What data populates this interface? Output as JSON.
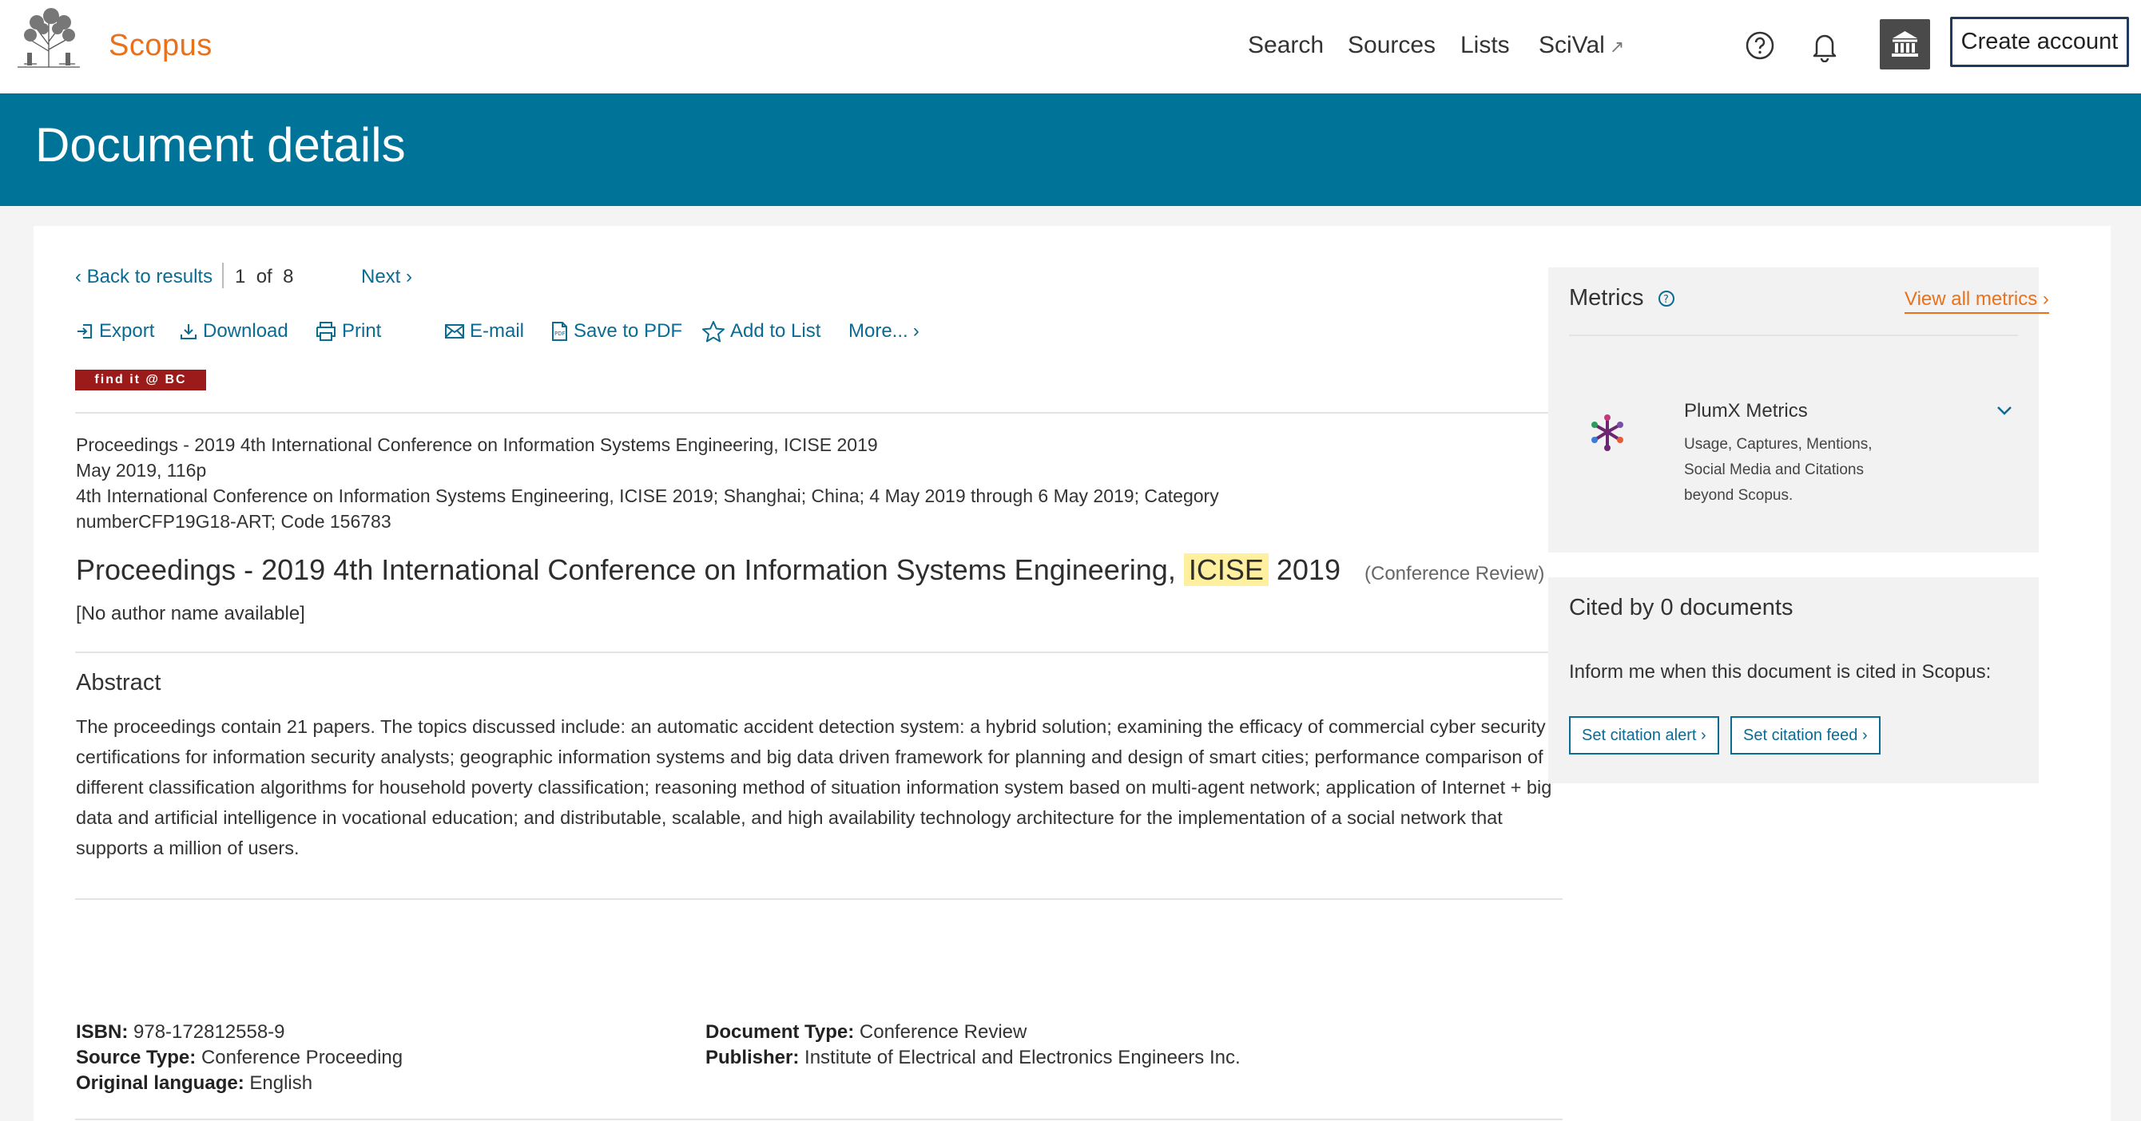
{
  "header": {
    "brand": "Scopus",
    "nav": [
      "Search",
      "Sources",
      "Lists",
      "SciVal"
    ],
    "create_account": "Create account"
  },
  "banner": {
    "title": "Document details"
  },
  "pager": {
    "back": "Back to results",
    "current": "1",
    "of": "of",
    "total": "8",
    "next": "Next"
  },
  "actions": {
    "export": "Export",
    "download": "Download",
    "print": "Print",
    "email": "E-mail",
    "save_pdf": "Save to PDF",
    "add_list": "Add to List",
    "more": "More..."
  },
  "findit": "find it @ BC",
  "source": {
    "line1": "Proceedings - 2019 4th International Conference on Information Systems Engineering, ICISE 2019",
    "line2": "May 2019, 116p",
    "line3": "4th International Conference on Information Systems Engineering, ICISE 2019; Shanghai; China; 4 May 2019 through 6 May 2019; Category",
    "line4": "numberCFP19G18-ART; Code 156783"
  },
  "document": {
    "title_before": "Proceedings - 2019 4th International Conference on Information Systems Engineering,",
    "title_highlight": "ICISE",
    "title_after": "2019",
    "type_label": "(Conference Review)",
    "author": "[No author name available]"
  },
  "abstract": {
    "heading": "Abstract",
    "text": "The proceedings contain 21 papers. The topics discussed include: an automatic accident detection system: a hybrid solution; examining the efficacy of commercial cyber security certifications for information security analysts; geographic information systems and big data driven framework for planning and design of smart cities; performance comparison of different classification algorithms for household poverty classification; reasoning method of situation information system based on multi-agent network; application of Internet + big data and artificial intelligence in vocational education; and distributable, scalable, and high availability technology architecture for the implementation of a social network that supports a million of users."
  },
  "details": {
    "isbn_label": "ISBN:",
    "isbn": "978-172812558-9",
    "source_type_label": "Source Type:",
    "source_type": "Conference Proceeding",
    "language_label": "Original language:",
    "language": "English",
    "doc_type_label": "Document Type:",
    "doc_type": "Conference Review",
    "publisher_label": "Publisher:",
    "publisher": "Institute of Electrical and Electronics Engineers Inc."
  },
  "metrics": {
    "heading": "Metrics",
    "view_all": "View all metrics",
    "plumx_title": "PlumX Metrics",
    "plumx_desc": "Usage, Captures, Mentions, Social Media and Citations beyond Scopus."
  },
  "cited": {
    "heading": "Cited by 0 documents",
    "inform": "Inform me when this document is cited in Scopus:",
    "alert_btn": "Set citation alert",
    "feed_btn": "Set citation feed"
  },
  "colors": {
    "banner": "#007398",
    "brand": "#e9711c",
    "link": "#0b6b93",
    "highlight": "#fff0a0",
    "findit": "#9b1b1b"
  },
  "icons": [
    "elsevier-tree-icon",
    "help-icon",
    "bell-icon",
    "institution-icon",
    "export-icon",
    "download-icon",
    "print-icon",
    "email-icon",
    "pdf-icon",
    "star-icon",
    "plumx-icon",
    "chevron-down-icon"
  ]
}
